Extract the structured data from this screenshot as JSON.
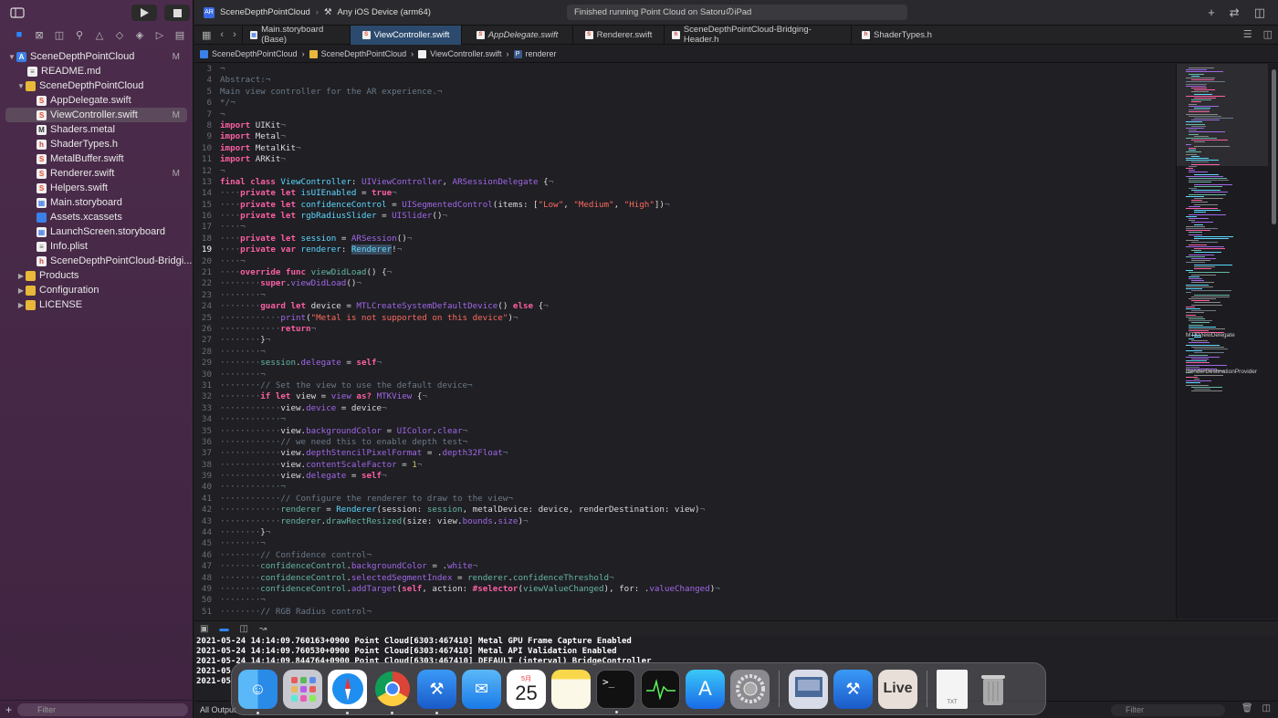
{
  "sidebar": {
    "project": "SceneDepthPointCloud",
    "project_badge": "M",
    "files": [
      {
        "name": "README.md",
        "kind": "md",
        "icon": "md"
      },
      {
        "name": "SceneDepthPointCloud",
        "kind": "folder",
        "icon": "folder"
      },
      {
        "name": "AppDelegate.swift",
        "kind": "swift",
        "icon": "swift"
      },
      {
        "name": "ViewController.swift",
        "kind": "swift",
        "icon": "swift",
        "badge": "M"
      },
      {
        "name": "Shaders.metal",
        "kind": "metal",
        "icon": "metal"
      },
      {
        "name": "ShaderTypes.h",
        "kind": "h",
        "icon": "h"
      },
      {
        "name": "MetalBuffer.swift",
        "kind": "swift",
        "icon": "swift"
      },
      {
        "name": "Renderer.swift",
        "kind": "swift",
        "icon": "swift",
        "badge": "M"
      },
      {
        "name": "Helpers.swift",
        "kind": "swift",
        "icon": "swift"
      },
      {
        "name": "Main.storyboard",
        "kind": "storyboard",
        "icon": "storyboard"
      },
      {
        "name": "Assets.xcassets",
        "kind": "xcassets",
        "icon": "xcassets"
      },
      {
        "name": "LaunchScreen.storyboard",
        "kind": "storyboard",
        "icon": "storyboard"
      },
      {
        "name": "Info.plist",
        "kind": "plist",
        "icon": "plist"
      },
      {
        "name": "SceneDepthPointCloud-Bridgi...",
        "kind": "h",
        "icon": "h"
      },
      {
        "name": "Products",
        "kind": "folder",
        "icon": "folder"
      },
      {
        "name": "Configuration",
        "kind": "folder",
        "icon": "folder"
      },
      {
        "name": "LICENSE",
        "kind": "folder",
        "icon": "folder"
      }
    ],
    "filter_placeholder": "Filter"
  },
  "toolbar": {
    "scheme": "SceneDepthPointCloud",
    "destination": "Any iOS Device (arm64)",
    "status": "Finished running Point Cloud on SatoruのiPad"
  },
  "tabs": [
    {
      "label": "Main.storyboard (Base)",
      "active": false
    },
    {
      "label": "ViewController.swift",
      "active": true
    },
    {
      "label": "AppDelegate.swift",
      "active": false
    },
    {
      "label": "Renderer.swift",
      "active": false
    },
    {
      "label": "SceneDepthPointCloud-Bridging-Header.h",
      "active": false
    },
    {
      "label": "ShaderTypes.h",
      "active": false
    }
  ],
  "breadcrumb": [
    "SceneDepthPointCloud",
    "SceneDepthPointCloud",
    "ViewController.swift",
    "renderer"
  ],
  "editor": {
    "current_line": "19",
    "first_line": 3
  },
  "minimap": {
    "labels": [
      "MTKViewDelegate",
      "RenderDestinationProvider"
    ]
  },
  "console": {
    "lines": [
      "2021-05-24 14:14:09.760163+0900 Point Cloud[6303:467410] Metal GPU Frame Capture Enabled",
      "2021-05-24 14:14:09.760530+0900 Point Cloud[6303:467410] Metal API Validation Enabled",
      "2021-05-24 14:14:09.844764+0900 Point Cloud[6303:467410] DEFAULT (interval) BridgeController",
      "2021-05",
      "2021-05"
    ],
    "output_filter": "All Output",
    "filter_placeholder": "Filter"
  },
  "dock": {
    "apps": [
      {
        "name": "Finder",
        "icon": "finder-icon",
        "bg": "#3a9af0",
        "running": true
      },
      {
        "name": "Launchpad",
        "icon": "launchpad-icon",
        "bg": "#c8c8d0",
        "running": false
      },
      {
        "name": "Safari",
        "icon": "safari-icon",
        "bg": "#1e8ef0",
        "running": true
      },
      {
        "name": "Chrome",
        "icon": "chrome-icon",
        "bg": "#ffffff",
        "running": true
      },
      {
        "name": "Xcode",
        "icon": "xcode-icon",
        "bg": "#2a7ae0",
        "running": true
      },
      {
        "name": "Mail",
        "icon": "mail-icon",
        "bg": "#2a8af0",
        "running": false
      },
      {
        "name": "Calendar",
        "icon": "calendar-icon",
        "bg": "#ffffff",
        "running": false,
        "month": "5月",
        "day": "25"
      },
      {
        "name": "Notes",
        "icon": "notes-icon",
        "bg": "#fbf4d0",
        "running": false
      },
      {
        "name": "Terminal",
        "icon": "terminal-icon",
        "bg": "#1a1a1a",
        "running": true
      },
      {
        "name": "Activity Monitor",
        "icon": "activity-icon",
        "bg": "#1a2a1a",
        "running": false
      },
      {
        "name": "App Store",
        "icon": "appstore-icon",
        "bg": "#1a8ef0",
        "running": false
      },
      {
        "name": "System Preferences",
        "icon": "settings-icon",
        "bg": "#7a7a80",
        "running": false
      }
    ],
    "apps2": [
      {
        "name": "Preview",
        "icon": "preview-icon",
        "bg": "#d8dce8",
        "running": false
      },
      {
        "name": "Instruments",
        "icon": "instruments-icon",
        "bg": "#2a7ae0",
        "running": false
      },
      {
        "name": "Live",
        "icon": "live-icon",
        "bg": "#e8e0d8",
        "running": false,
        "label": "Live"
      }
    ],
    "file_label": "TXT"
  },
  "colors": {
    "accent": "#2f86ff",
    "keyword": "#fc5fa3",
    "type": "#5dd8ff",
    "string": "#fc6a5d"
  }
}
